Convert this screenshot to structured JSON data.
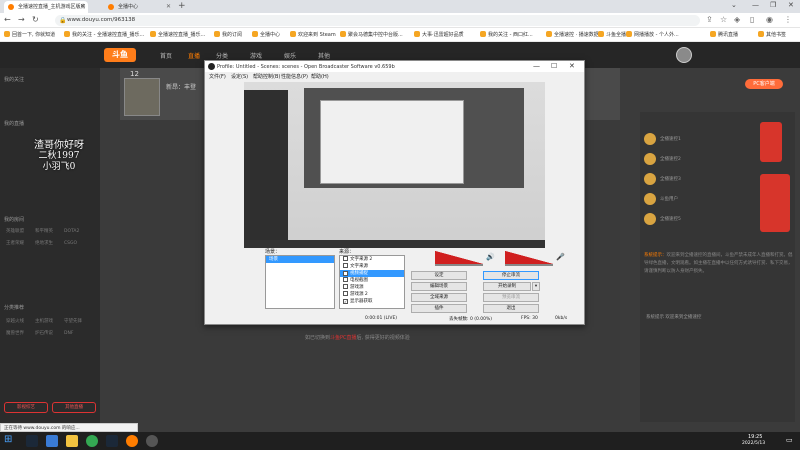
{
  "browser": {
    "tabs": [
      {
        "label": "全播速控直播_主机游戏区版房"
      },
      {
        "label": "全播中心"
      }
    ],
    "url": "www.douyu.com/963138",
    "bookmarks": [
      "回首一下, 你就知道",
      "我的关注 - 全播速控直播_播乐...",
      "全播速控直播_播乐...",
      "我的订阅",
      "全播中心",
      "欢迎来到 Steam",
      "聚会马德集中控中台版...",
      "大事·迅雷超好品质",
      "我的关注 - 西口红...",
      "全播速控 · 播速数据",
      "斗鱼全播",
      "网播播放 - 个人外...",
      "腾讯直播",
      "其他书签"
    ],
    "status_url": "正在等待 www.douyu.com 的响应..."
  },
  "douyu": {
    "logo": "斗鱼",
    "nav": [
      "首页",
      "直播",
      "分类",
      "游戏",
      "娱乐",
      "其他"
    ],
    "fans": "12",
    "streamer_prefix": "新昂：丰登",
    "overlay_lines": [
      "渣哥你好呀",
      "二秋1997",
      "小羽飞0"
    ],
    "sidebar_sections": [
      "我的关注",
      "我的直播",
      "我的房间",
      "分类推荐"
    ],
    "sidebar_grid": [
      "英雄联盟",
      "和平精英",
      "DOTA2",
      "王者荣耀",
      "绝地求生",
      "CSGO",
      "穿越火线",
      "主机游戏",
      "守望先锋",
      "魔兽世界",
      "炉石传说",
      "DNF"
    ],
    "sidebar_btns": [
      "影视综艺",
      "其他直播"
    ],
    "caption_pre": "如已切换到",
    "caption_hl": "斗鱼PC直播",
    "caption_post": "后, 获得更好的视频体验",
    "chat_users": [
      "全播速控1",
      "全播速控2",
      "全播速控3",
      "斗鱼用户",
      "全播速控5"
    ],
    "chat_main_user": "系统提示：",
    "chat_main_text": "欢迎来到全播速控的直播间，斗鱼严禁未成年人直播和打赏。倡导绿色直播，文明观看。如主播在直播中以任何方式诱导打赏、私下交易，请谨慎判断以防人身财产损失。",
    "chat_footer": "系统提示 欢迎来到全播速控",
    "gift_btn": "PC客户端",
    "colors": {
      "accent": "#ff7d00",
      "header": "#262626"
    }
  },
  "obs": {
    "title": "Profile: Untitled - Scenes: scenes - Open Broadcaster Software v0.659b",
    "menu": [
      "文件(F)",
      "设定(S)",
      "帮助控制(B)",
      "性能信息(P)",
      "帮助(H)"
    ],
    "scenes_label": "场景：",
    "scenes": [
      "场景"
    ],
    "sources_label": "来源：",
    "sources": [
      {
        "name": "文字来源 2",
        "checked": false
      },
      {
        "name": "文字来源",
        "checked": false
      },
      {
        "name": "视频捕捉",
        "checked": true,
        "selected": true
      },
      {
        "name": "电视截图",
        "checked": false
      },
      {
        "name": "游戏源",
        "checked": false
      },
      {
        "name": "游戏源 2",
        "checked": false
      },
      {
        "name": "显示器获取",
        "checked": true
      }
    ],
    "buttons": {
      "settings": "设定",
      "stop_stream": "停止串流",
      "edit_scene": "编辑场景",
      "start_record": "开始录制",
      "global_sources": "全域来源",
      "preview_stream": "预览串流",
      "plugins": "插件",
      "exit": "退出"
    },
    "status": {
      "time": "0:00:01 (LIVE)",
      "dropped": "丢失帧数: 0 (0.00%)",
      "fps": "FPS: 30",
      "bitrate": "0kb/s"
    }
  },
  "taskbar": {
    "time": "19:25",
    "date": "2022/5/13"
  }
}
